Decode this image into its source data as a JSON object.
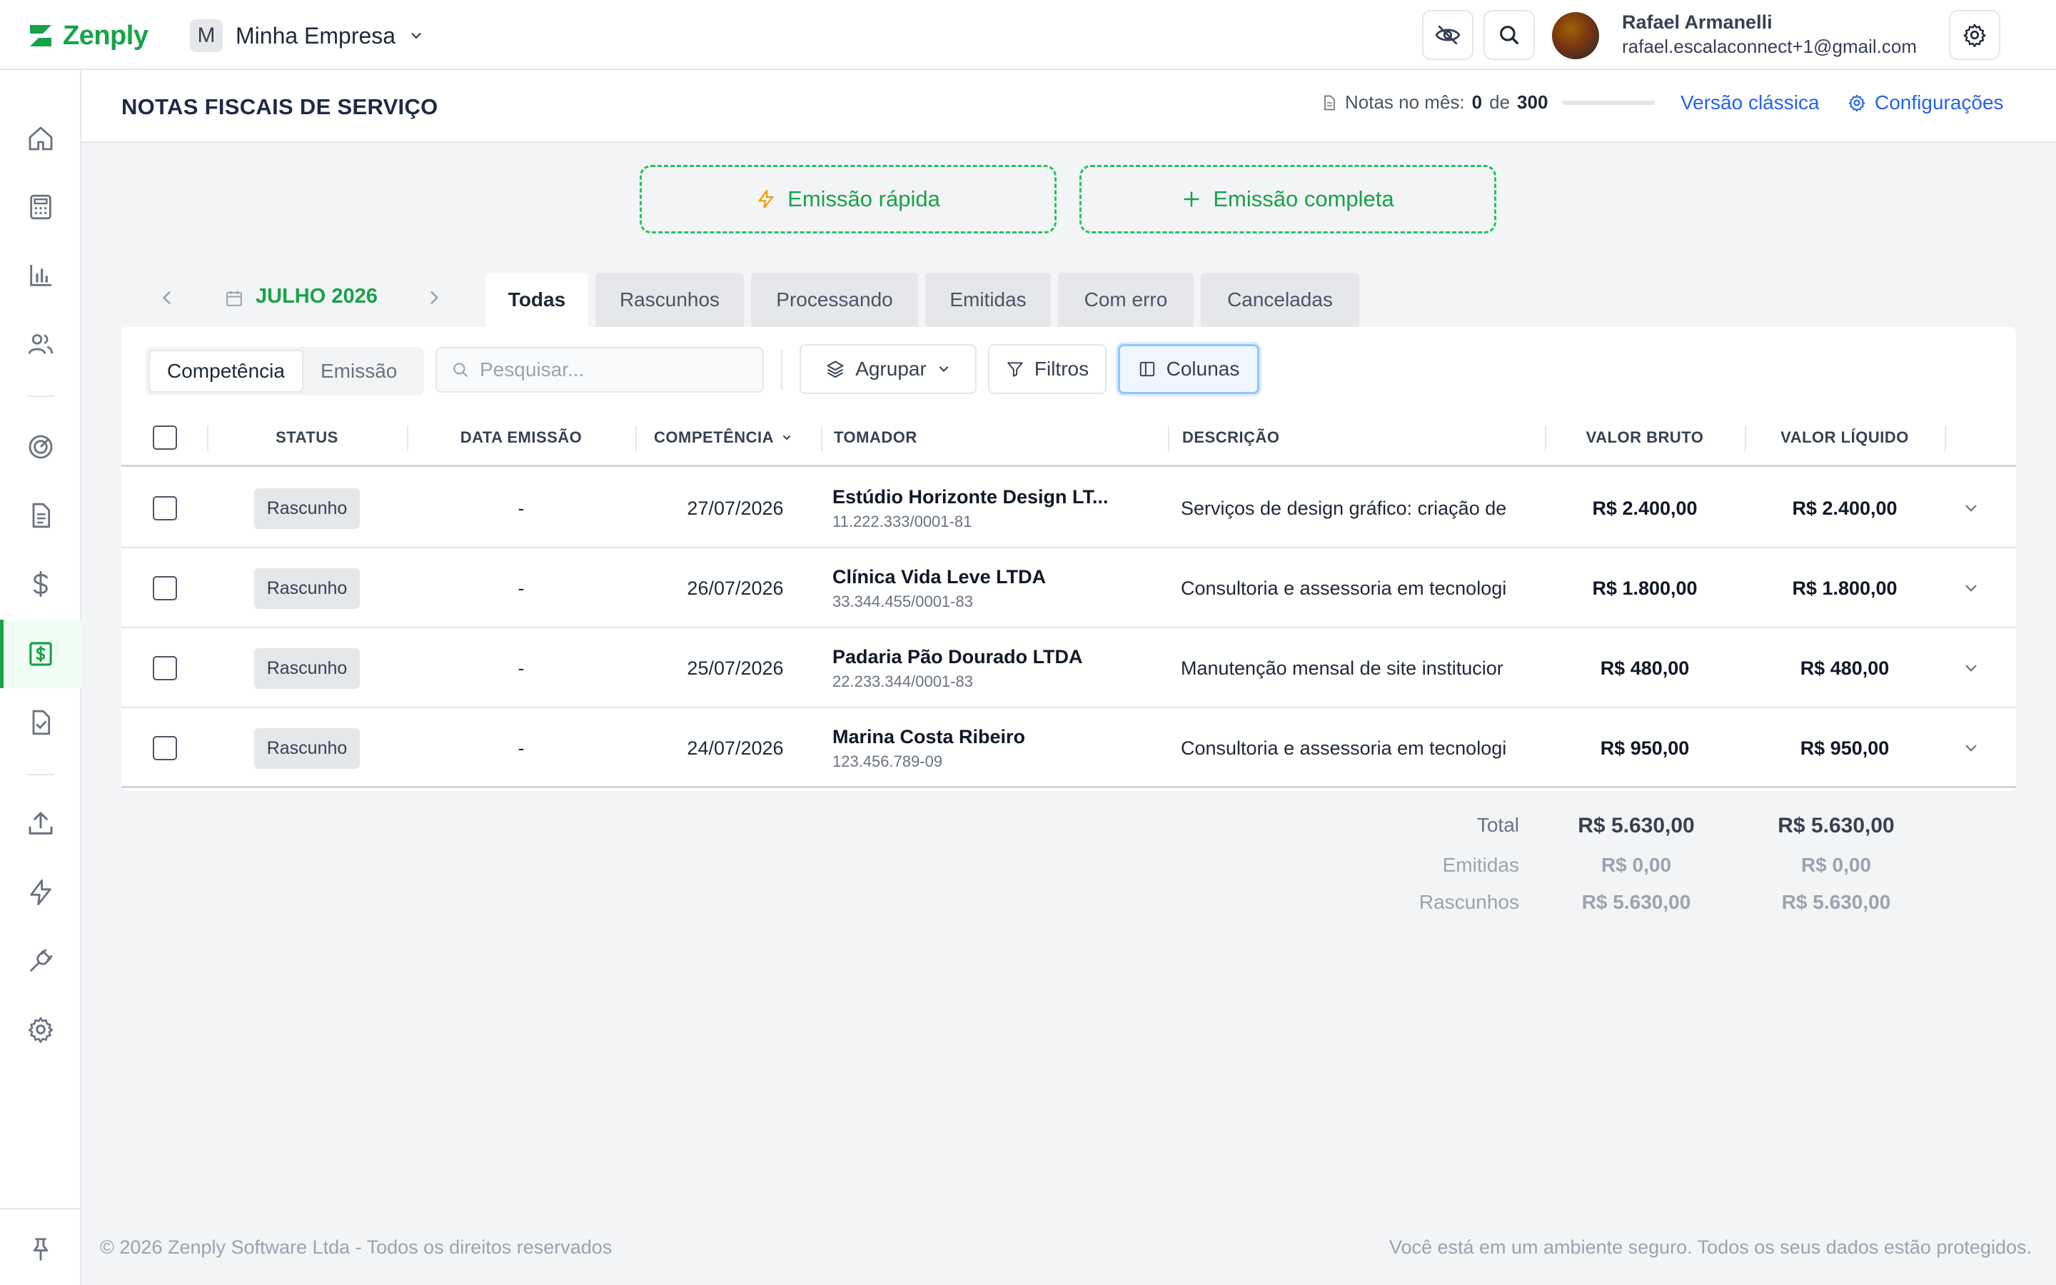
{
  "app": {
    "brand": "Zenply",
    "brand_color": "#16a34a",
    "accent_color": "#2563eb"
  },
  "company": {
    "initial": "M",
    "name": "Minha Empresa"
  },
  "user": {
    "name": "Rafael Armanelli",
    "email": "rafael.escalaconnect+1@gmail.com"
  },
  "header": {
    "title": "NOTAS FISCAIS DE SERVIÇO",
    "notes_label": "Notas no mês:",
    "notes_used": "0",
    "notes_of": "de",
    "notes_limit": "300",
    "notes_progress": 0,
    "classic_link": "Versão clássica",
    "config_link": "Configurações"
  },
  "emission": {
    "quick": "Emissão rápida",
    "complete": "Emissão completa"
  },
  "period": {
    "label": "JULHO 2026"
  },
  "tabs": [
    "Todas",
    "Rascunhos",
    "Processando",
    "Emitidas",
    "Com erro",
    "Canceladas"
  ],
  "toolbar": {
    "date_mode": [
      "Competência",
      "Emissão"
    ],
    "search_placeholder": "Pesquisar...",
    "group": "Agrupar",
    "filters": "Filtros",
    "columns": "Colunas"
  },
  "table": {
    "headers": {
      "status": "STATUS",
      "issue_date": "DATA EMISSÃO",
      "competence": "COMPETÊNCIA",
      "client": "TOMADOR",
      "description": "DESCRIÇÃO",
      "gross": "VALOR BRUTO",
      "net": "VALOR LÍQUIDO"
    },
    "rows": [
      {
        "status": "Rascunho",
        "issue_date": "-",
        "competence": "27/07/2026",
        "client": "Estúdio Horizonte Design LT...",
        "doc": "11.222.333/0001-81",
        "description": "Serviços de design gráfico: criação de",
        "gross": "R$ 2.400,00",
        "net": "R$ 2.400,00"
      },
      {
        "status": "Rascunho",
        "issue_date": "-",
        "competence": "26/07/2026",
        "client": "Clínica Vida Leve LTDA",
        "doc": "33.344.455/0001-83",
        "description": "Consultoria e assessoria em tecnologi",
        "gross": "R$ 1.800,00",
        "net": "R$ 1.800,00"
      },
      {
        "status": "Rascunho",
        "issue_date": "-",
        "competence": "25/07/2026",
        "client": "Padaria Pão Dourado LTDA",
        "doc": "22.233.344/0001-83",
        "description": "Manutenção mensal de site institucior",
        "gross": "R$ 480,00",
        "net": "R$ 480,00"
      },
      {
        "status": "Rascunho",
        "issue_date": "-",
        "competence": "24/07/2026",
        "client": "Marina Costa Ribeiro",
        "doc": "123.456.789-09",
        "description": "Consultoria e assessoria em tecnologi",
        "gross": "R$ 950,00",
        "net": "R$ 950,00"
      }
    ]
  },
  "totals": {
    "total_label": "Total",
    "total_gross": "R$ 5.630,00",
    "total_net": "R$ 5.630,00",
    "issued_label": "Emitidas",
    "issued_gross": "R$ 0,00",
    "issued_net": "R$ 0,00",
    "drafts_label": "Rascunhos",
    "drafts_gross": "R$ 5.630,00",
    "drafts_net": "R$ 5.630,00"
  },
  "footer": {
    "copyright": "© 2026 Zenply Software Ltda - Todos os direitos reservados",
    "security": "Você está em um ambiente seguro. Todos os seus dados estão protegidos."
  }
}
